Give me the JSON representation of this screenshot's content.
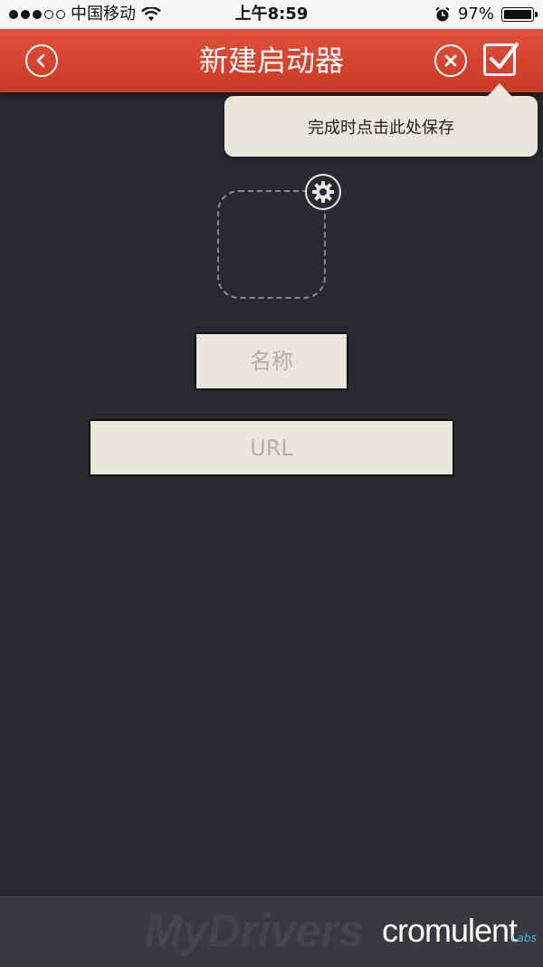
{
  "status_bar": {
    "carrier": "中国移动",
    "time": "上午8:59",
    "battery_percent": "97%",
    "battery_level": 0.97,
    "signal_bars_filled": 3,
    "signal_bars_total": 5,
    "icons": [
      "signal-dots-icon",
      "wifi-icon",
      "alarm-icon",
      "battery-icon"
    ]
  },
  "header": {
    "title": "新建启动器",
    "background_color": "#d4432f",
    "icons": [
      "back-icon",
      "close-icon",
      "checkmark-icon"
    ]
  },
  "tooltip": {
    "text": "完成时点击此处保存"
  },
  "icon_editor": {
    "icon": "gear-icon"
  },
  "form": {
    "name_placeholder": "名称",
    "url_placeholder": "URL"
  },
  "footer": {
    "watermark": "MyDrivers",
    "brand": "cromulent",
    "brand_sub": "Labs"
  }
}
